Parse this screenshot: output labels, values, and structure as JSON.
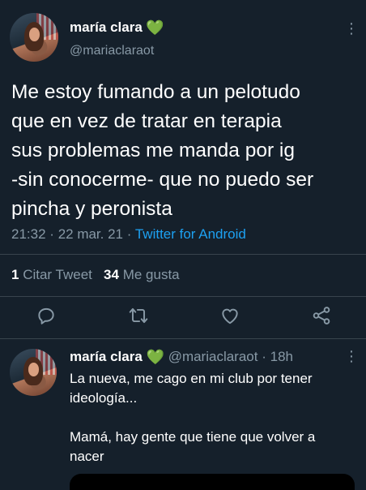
{
  "main_tweet": {
    "author_name": "maría clara",
    "author_handle": "@mariaclaraot",
    "verified_emoji": "heart-green",
    "text": "Me estoy fumando a un pelotudo\nque en vez de tratar en terapia\nsus problemas me manda por ig\n-sin conocerme- que no puedo ser\npincha y peronista",
    "time": "21:32",
    "date": "22 mar. 21",
    "client": "Twitter for Android",
    "separator": "·",
    "quote_count": "1",
    "quote_label": "Citar Tweet",
    "like_count": "34",
    "like_label": "Me gusta"
  },
  "actions": {
    "reply_icon": "reply-icon",
    "retweet_icon": "retweet-icon",
    "like_icon": "heart-icon",
    "share_icon": "share-icon"
  },
  "reply_tweet": {
    "author_name": "maría clara",
    "author_handle": "@mariaclaraot",
    "separator": "·",
    "time_ago": "18h",
    "text": "La nueva, me cago en mi club por tener\nideología...\n\nMamá, hay gente que tiene que volver a\nnacer"
  },
  "colors": {
    "background": "#15202b",
    "muted": "#8899a6",
    "link": "#1da1f2",
    "heart": "#7ed957",
    "divider": "#38444d"
  }
}
